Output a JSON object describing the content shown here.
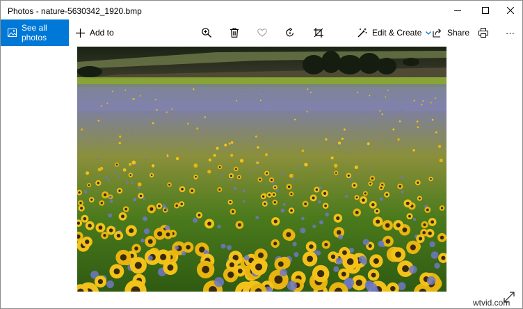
{
  "window": {
    "title": "Photos - nature-5630342_1920.bmp",
    "controls": {
      "minimize": "minimize-icon",
      "maximize": "maximize-icon",
      "close": "close-icon"
    }
  },
  "toolbar": {
    "see_all_photos": "See all photos",
    "add_to": "Add to",
    "zoom": "zoom-in-icon",
    "delete": "trash-icon",
    "favorite": "heart-icon",
    "rotate": "rotate-icon",
    "crop": "crop-icon",
    "edit_create": "Edit & Create",
    "share": "Share",
    "print": "print-icon",
    "more": "···"
  },
  "photo": {
    "subject": "sunflower field",
    "expand": "expand-icon"
  },
  "watermark": "wtvid.com",
  "colors": {
    "accent": "#0078d7",
    "sky": "#1b2418",
    "field_green": "#3e6e16",
    "sunflower": "#f2c21a"
  }
}
